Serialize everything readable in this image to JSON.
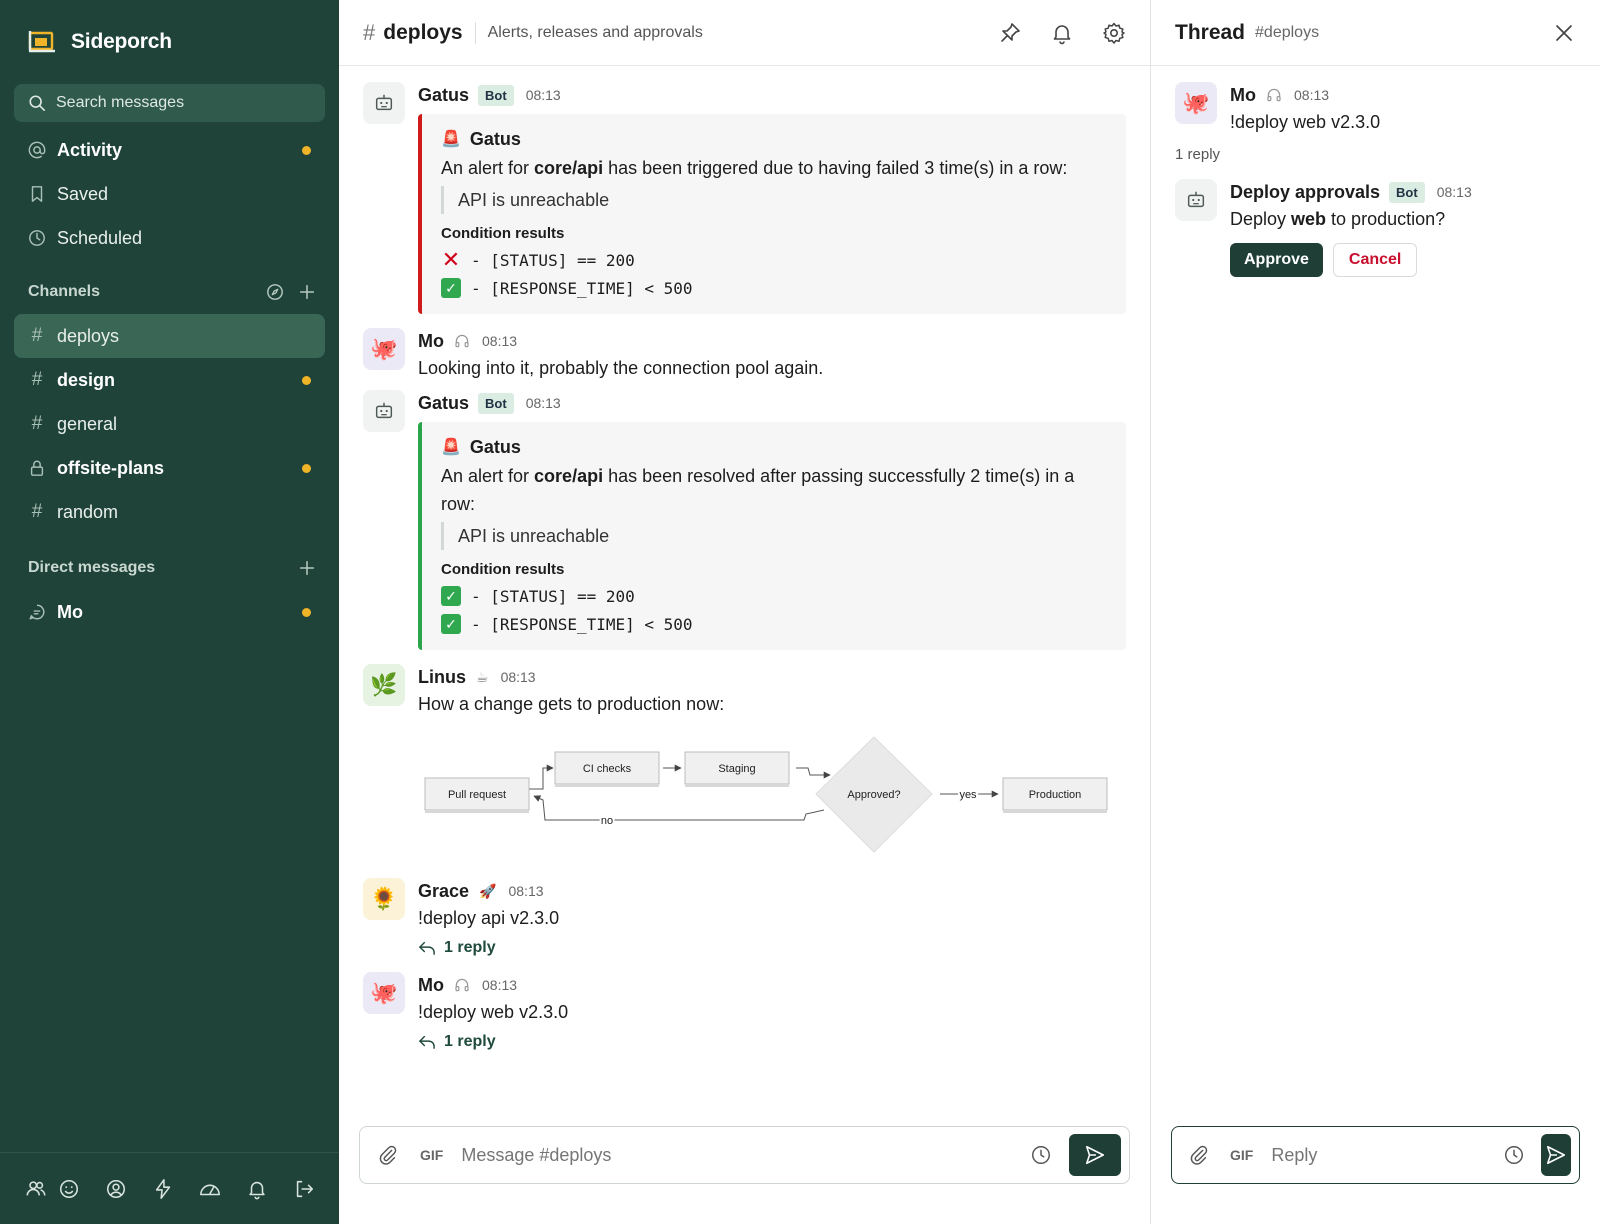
{
  "app": {
    "name": "Sideporch"
  },
  "colors": {
    "sidebar": "#1f4339",
    "accent": "#1f3f36",
    "unread_dot": "#f0b429",
    "alert_red": "#d11a1a",
    "alert_green": "#2ba54a"
  },
  "sidebar": {
    "search_placeholder": "Search messages",
    "nav": [
      {
        "label": "Activity",
        "icon": "at-icon",
        "unread": true
      },
      {
        "label": "Saved",
        "icon": "bookmark-icon",
        "unread": false
      },
      {
        "label": "Scheduled",
        "icon": "clock-icon",
        "unread": false
      }
    ],
    "channels_header": "Channels",
    "channels": [
      {
        "name": "deploys",
        "icon": "#",
        "active": true,
        "unread": false,
        "bold": false
      },
      {
        "name": "design",
        "icon": "#",
        "active": false,
        "unread": true,
        "bold": true
      },
      {
        "name": "general",
        "icon": "#",
        "active": false,
        "unread": false,
        "bold": false
      },
      {
        "name": "offsite-plans",
        "icon": "lock",
        "active": false,
        "unread": true,
        "bold": true
      },
      {
        "name": "random",
        "icon": "#",
        "active": false,
        "unread": false,
        "bold": false
      }
    ],
    "dm_header": "Direct messages",
    "dms": [
      {
        "name": "Mo",
        "unread": true
      }
    ]
  },
  "header": {
    "hash": "#",
    "channel": "deploys",
    "topic": "Alerts, releases and approvals"
  },
  "messages": [
    {
      "author": "Gatus",
      "badge": "Bot",
      "time": "08:13",
      "card": {
        "title": "Gatus",
        "text_pre": "An alert for ",
        "text_bold": "core/api",
        "text_post": " has been triggered due to having failed 3 time(s) in a row:",
        "quote": "API is unreachable",
        "conditions_header": "Condition results",
        "conditions": [
          {
            "mark": "✕",
            "text": "- [STATUS] == 200"
          },
          {
            "mark": "✓",
            "text": "- [RESPONSE_TIME] < 500"
          }
        ]
      }
    },
    {
      "author": "Mo",
      "time": "08:13",
      "text": "Looking into it, probably the connection pool again."
    },
    {
      "author": "Gatus",
      "badge": "Bot",
      "time": "08:13",
      "card": {
        "title": "Gatus",
        "text_pre": "An alert for ",
        "text_bold": "core/api",
        "text_post": " has been resolved after passing successfully 2 time(s) in a row:",
        "quote": "API is unreachable",
        "conditions_header": "Condition results",
        "conditions": [
          {
            "mark": "✓",
            "text": "- [STATUS] == 200"
          },
          {
            "mark": "✓",
            "text": "- [RESPONSE_TIME] < 500"
          }
        ]
      }
    },
    {
      "author": "Linus",
      "time": "08:13",
      "text": "How a change gets to production now:",
      "diagram": {
        "nodes": [
          "Pull request",
          "CI checks",
          "Staging",
          "Approved?",
          "Production"
        ],
        "edge_yes": "yes",
        "edge_no": "no"
      }
    },
    {
      "author": "Grace",
      "time": "08:13",
      "text": "!deploy api v2.3.0",
      "replies": "1 reply"
    },
    {
      "author": "Mo",
      "time": "08:13",
      "text": "!deploy web v2.3.0",
      "replies": "1 reply"
    }
  ],
  "composer": {
    "gif": "GIF",
    "placeholder": "Message #deploys"
  },
  "thread": {
    "title": "Thread",
    "channel": "#deploys",
    "root": {
      "author": "Mo",
      "time": "08:13",
      "text": "!deploy web v2.3.0"
    },
    "reply_count": "1 reply",
    "reply": {
      "author": "Deploy approvals",
      "badge": "Bot",
      "time": "08:13",
      "text_pre": "Deploy ",
      "text_bold": "web",
      "text_post": " to production?",
      "approve": "Approve",
      "cancel": "Cancel"
    },
    "composer": {
      "gif": "GIF",
      "placeholder": "Reply"
    }
  }
}
